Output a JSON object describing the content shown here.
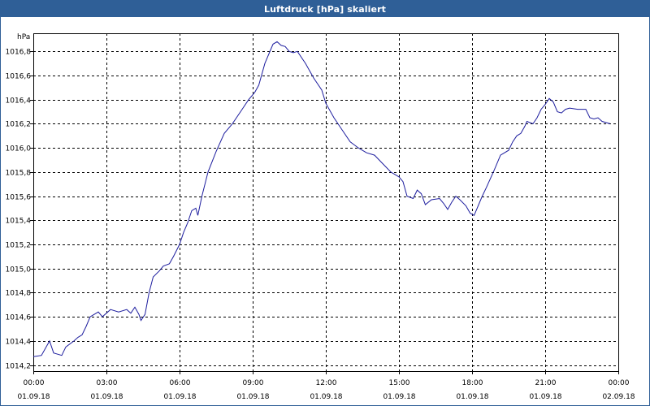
{
  "title": "Luftdruck [hPa] skaliert",
  "colors": {
    "titlebar": "#2f5f97",
    "line": "#1d1d9e",
    "grid": "#000000"
  },
  "chart_data": {
    "type": "line",
    "title": "Luftdruck [hPa] skaliert",
    "ylabel": "hPa",
    "xlabel": "",
    "ylim": [
      1014.15,
      1016.95
    ],
    "xlim": [
      "01.09.18 00:00",
      "02.09.18 00:00"
    ],
    "grid": true,
    "grid_style": "dashed",
    "legend": false,
    "y_ticks": [
      "1014,2",
      "1014,4",
      "1014,6",
      "1014,8",
      "1015,0",
      "1015,2",
      "1015,4",
      "1015,6",
      "1015,8",
      "1016,0",
      "1016,2",
      "1016,4",
      "1016,6",
      "1016,8"
    ],
    "x_ticks": [
      {
        "time": "00:00",
        "date": "01.09.18"
      },
      {
        "time": "03:00",
        "date": "01.09.18"
      },
      {
        "time": "06:00",
        "date": "01.09.18"
      },
      {
        "time": "09:00",
        "date": "01.09.18"
      },
      {
        "time": "12:00",
        "date": "01.09.18"
      },
      {
        "time": "15:00",
        "date": "01.09.18"
      },
      {
        "time": "18:00",
        "date": "01.09.18"
      },
      {
        "time": "21:00",
        "date": "01.09.18"
      },
      {
        "time": "00:00",
        "date": "02.09.18"
      }
    ],
    "series": [
      {
        "points": [
          [
            "01.09.18 00:00",
            1014.27
          ],
          [
            "01.09.18 00:20",
            1014.28
          ],
          [
            "01.09.18 00:40",
            1014.4
          ],
          [
            "01.09.18 00:50",
            1014.3
          ],
          [
            "01.09.18 01:10",
            1014.28
          ],
          [
            "01.09.18 01:20",
            1014.35
          ],
          [
            "01.09.18 01:40",
            1014.4
          ],
          [
            "01.09.18 01:50",
            1014.43
          ],
          [
            "01.09.18 02:00",
            1014.45
          ],
          [
            "01.09.18 02:10",
            1014.52
          ],
          [
            "01.09.18 02:20",
            1014.6
          ],
          [
            "01.09.18 02:40",
            1014.64
          ],
          [
            "01.09.18 02:50",
            1014.6
          ],
          [
            "01.09.18 03:10",
            1014.66
          ],
          [
            "01.09.18 03:30",
            1014.64
          ],
          [
            "01.09.18 03:50",
            1014.66
          ],
          [
            "01.09.18 04:00",
            1014.63
          ],
          [
            "01.09.18 04:10",
            1014.68
          ],
          [
            "01.09.18 04:20",
            1014.62
          ],
          [
            "01.09.18 04:25",
            1014.57
          ],
          [
            "01.09.18 04:35",
            1014.62
          ],
          [
            "01.09.18 04:45",
            1014.8
          ],
          [
            "01.09.18 04:55",
            1014.93
          ],
          [
            "01.09.18 05:10",
            1014.98
          ],
          [
            "01.09.18 05:20",
            1015.02
          ],
          [
            "01.09.18 05:35",
            1015.04
          ],
          [
            "01.09.18 05:45",
            1015.1
          ],
          [
            "01.09.18 06:00",
            1015.2
          ],
          [
            "01.09.18 06:10",
            1015.3
          ],
          [
            "01.09.18 06:20",
            1015.38
          ],
          [
            "01.09.18 06:30",
            1015.48
          ],
          [
            "01.09.18 06:40",
            1015.5
          ],
          [
            "01.09.18 06:45",
            1015.44
          ],
          [
            "01.09.18 06:55",
            1015.6
          ],
          [
            "01.09.18 07:10",
            1015.8
          ],
          [
            "01.09.18 07:30",
            1015.97
          ],
          [
            "01.09.18 07:50",
            1016.12
          ],
          [
            "01.09.18 08:10",
            1016.2
          ],
          [
            "01.09.18 08:30",
            1016.3
          ],
          [
            "01.09.18 08:50",
            1016.4
          ],
          [
            "01.09.18 09:05",
            1016.46
          ],
          [
            "01.09.18 09:15",
            1016.52
          ],
          [
            "01.09.18 09:30",
            1016.7
          ],
          [
            "01.09.18 09:50",
            1016.86
          ],
          [
            "01.09.18 10:00",
            1016.88
          ],
          [
            "01.09.18 10:10",
            1016.85
          ],
          [
            "01.09.18 10:20",
            1016.84
          ],
          [
            "01.09.18 10:30",
            1016.8
          ],
          [
            "01.09.18 10:40",
            1016.79
          ],
          [
            "01.09.18 10:50",
            1016.8
          ],
          [
            "01.09.18 11:10",
            1016.7
          ],
          [
            "01.09.18 11:30",
            1016.58
          ],
          [
            "01.09.18 11:50",
            1016.48
          ],
          [
            "01.09.18 12:00",
            1016.37
          ],
          [
            "01.09.18 12:20",
            1016.25
          ],
          [
            "01.09.18 12:40",
            1016.15
          ],
          [
            "01.09.18 13:00",
            1016.05
          ],
          [
            "01.09.18 13:20",
            1016.0
          ],
          [
            "01.09.18 13:40",
            1015.96
          ],
          [
            "01.09.18 14:00",
            1015.94
          ],
          [
            "01.09.18 14:20",
            1015.87
          ],
          [
            "01.09.18 14:40",
            1015.8
          ],
          [
            "01.09.18 15:00",
            1015.76
          ],
          [
            "01.09.18 15:10",
            1015.72
          ],
          [
            "01.09.18 15:20",
            1015.6
          ],
          [
            "01.09.18 15:35",
            1015.58
          ],
          [
            "01.09.18 15:45",
            1015.65
          ],
          [
            "01.09.18 15:55",
            1015.62
          ],
          [
            "01.09.18 16:05",
            1015.53
          ],
          [
            "01.09.18 16:20",
            1015.57
          ],
          [
            "01.09.18 16:40",
            1015.58
          ],
          [
            "01.09.18 16:50",
            1015.54
          ],
          [
            "01.09.18 17:00",
            1015.49
          ],
          [
            "01.09.18 17:10",
            1015.55
          ],
          [
            "01.09.18 17:20",
            1015.6
          ],
          [
            "01.09.18 17:30",
            1015.57
          ],
          [
            "01.09.18 17:45",
            1015.52
          ],
          [
            "01.09.18 17:55",
            1015.46
          ],
          [
            "01.09.18 18:05",
            1015.44
          ],
          [
            "01.09.18 18:15",
            1015.52
          ],
          [
            "01.09.18 18:25",
            1015.6
          ],
          [
            "01.09.18 18:35",
            1015.67
          ],
          [
            "01.09.18 18:55",
            1015.82
          ],
          [
            "01.09.18 19:10",
            1015.94
          ],
          [
            "01.09.18 19:30",
            1015.98
          ],
          [
            "01.09.18 19:40",
            1016.05
          ],
          [
            "01.09.18 19:50",
            1016.1
          ],
          [
            "01.09.18 20:00",
            1016.12
          ],
          [
            "01.09.18 20:10",
            1016.18
          ],
          [
            "01.09.18 20:15",
            1016.22
          ],
          [
            "01.09.18 20:30",
            1016.2
          ],
          [
            "01.09.18 20:40",
            1016.25
          ],
          [
            "01.09.18 20:50",
            1016.32
          ],
          [
            "01.09.18 21:00",
            1016.36
          ],
          [
            "01.09.18 21:10",
            1016.41
          ],
          [
            "01.09.18 21:20",
            1016.38
          ],
          [
            "01.09.18 21:30",
            1016.3
          ],
          [
            "01.09.18 21:40",
            1016.29
          ],
          [
            "01.09.18 21:50",
            1016.32
          ],
          [
            "01.09.18 22:00",
            1016.33
          ],
          [
            "01.09.18 22:20",
            1016.32
          ],
          [
            "01.09.18 22:40",
            1016.32
          ],
          [
            "01.09.18 22:50",
            1016.25
          ],
          [
            "01.09.18 23:00",
            1016.24
          ],
          [
            "01.09.18 23:10",
            1016.25
          ],
          [
            "01.09.18 23:20",
            1016.22
          ],
          [
            "01.09.18 23:40",
            1016.2
          ]
        ]
      }
    ]
  }
}
